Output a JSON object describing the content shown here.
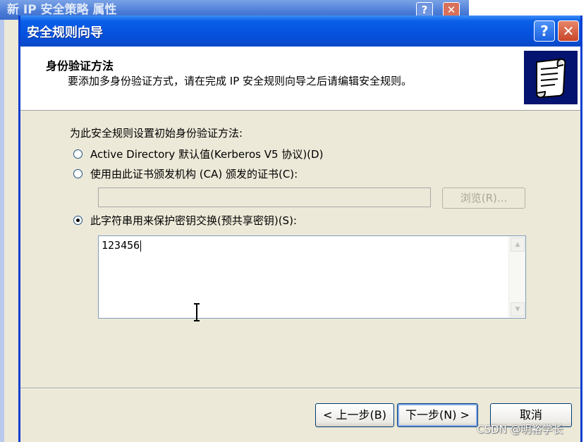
{
  "background_window": {
    "title": "新 IP 安全策略 属性",
    "help_label": "?",
    "close_label": "✕"
  },
  "dialog": {
    "title": "安全规则向导",
    "help_label": "?",
    "close_label": "✕"
  },
  "header": {
    "title": "身份验证方法",
    "description": "要添加多身份验证方式，请在完成 IP 安全规则向导之后请编辑安全规则。",
    "icon": "scroll-document-icon"
  },
  "body": {
    "prompt": "为此安全规则设置初始身份验证方法:",
    "options": [
      {
        "label": "Active Directory 默认值(Kerberos V5 协议)(D)",
        "selected": false
      },
      {
        "label": "使用由此证书颁发机构 (CA) 颁发的证书(C):",
        "selected": false
      },
      {
        "label": "此字符串用来保护密钥交换(预共享密钥)(S):",
        "selected": true
      }
    ],
    "certificate_value": "",
    "browse_label": "浏览(R)...",
    "preshared_key_value": "123456"
  },
  "buttons": {
    "back": "< 上一步(B)",
    "next": "下一步(N) >",
    "cancel": "取消"
  },
  "watermark": "CSDN @明裕学长",
  "colors": {
    "titlebar": "#0552df",
    "dialog_bg": "#ece9d8",
    "header_icon_bg": "#04136f"
  }
}
